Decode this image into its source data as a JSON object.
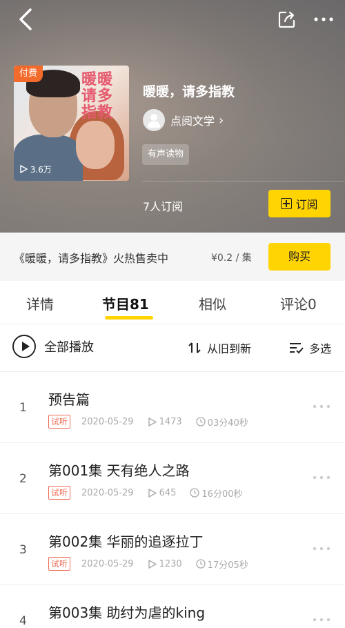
{
  "header": {
    "cover_badge": "付费",
    "cover_title": "暖暖请多指教",
    "cover_plays": "3.6万",
    "title": "暖暖，请多指教",
    "author": "点阅文学",
    "tag": "有声读物",
    "subscribers": "7人订阅",
    "subscribe_label": "订阅"
  },
  "purchase": {
    "text": "《暖暖，请多指教》火热售卖中",
    "price": "¥0.2 / 集",
    "buy_label": "购买"
  },
  "tabs": [
    {
      "label": "详情"
    },
    {
      "label": "节目81",
      "active": true
    },
    {
      "label": "相似"
    },
    {
      "label": "评论0"
    }
  ],
  "toolbar": {
    "play_all": "全部播放",
    "sort": "从旧到新",
    "multi": "多选"
  },
  "episodes": [
    {
      "num": "1",
      "title": "预告篇",
      "badge": "试听",
      "date": "2020-05-29",
      "plays": "1473",
      "duration": "03分40秒"
    },
    {
      "num": "2",
      "title": "第001集 天有绝人之路",
      "badge": "试听",
      "date": "2020-05-29",
      "plays": "645",
      "duration": "16分00秒"
    },
    {
      "num": "3",
      "title": "第002集 华丽的追逐拉丁",
      "badge": "试听",
      "date": "2020-05-29",
      "plays": "1230",
      "duration": "17分05秒"
    },
    {
      "num": "4",
      "title": "第003集 助纣为虐的king",
      "badge": "",
      "date": "",
      "plays": "",
      "duration": ""
    }
  ],
  "colors": {
    "accent": "#ffd400",
    "badge": "#f26b2d",
    "trial": "#ef6a55"
  },
  "icons": [
    "back-icon",
    "share-icon",
    "more-icon",
    "play-circle-icon",
    "sort-icon",
    "multi-select-icon",
    "play-count-icon",
    "clock-icon",
    "item-more-icon"
  ]
}
